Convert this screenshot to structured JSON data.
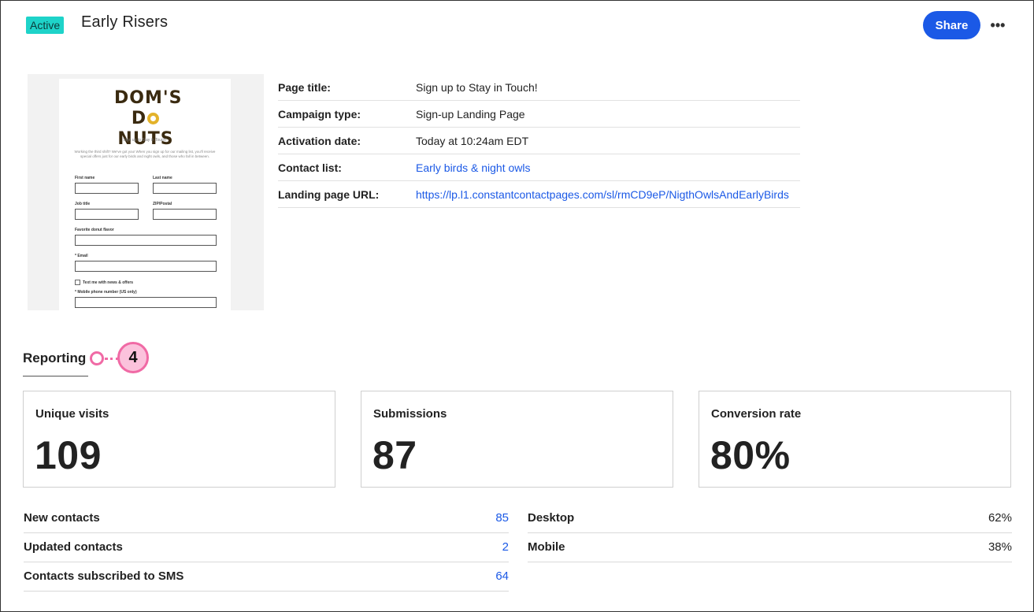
{
  "header": {
    "status_badge": "Active",
    "title": "Early Risers",
    "share_label": "Share",
    "more_label": "•••"
  },
  "preview": {
    "logo_line1_a": "DOM'S",
    "logo_line2_a": "D",
    "logo_line2_b": "NUTS",
    "subtitle": "Sign up to Stay in Touch!",
    "description": "Working the third shift? We've got you! When you sign up for our mailing list, you'll receive special offers just for our early birds and night owls, and those who fall in between.",
    "fields": {
      "first_name": "First name",
      "last_name": "Last name",
      "job_title": "Job title",
      "zip": "ZIP/Postal",
      "donut_flavor": "Favorite donut flavor",
      "email": "* Email",
      "text_me": "Text me with news & offers",
      "mobile": "* Mobile phone number (US only)"
    }
  },
  "details": [
    {
      "label": "Page title:",
      "value": "Sign up to Stay in Touch!"
    },
    {
      "label": "Campaign type:",
      "value": "Sign-up Landing Page"
    },
    {
      "label": "Activation date:",
      "value": "Today at 10:24am EDT"
    },
    {
      "label": "Contact list:",
      "value": "Early birds & night owls"
    },
    {
      "label": "Landing page URL:",
      "value": "https://lp.l1.constantcontactpages.com/sl/rmCD9eP/NigthOwlsAndEarlyBirds"
    }
  ],
  "reporting": {
    "title": "Reporting",
    "callout_number": "4",
    "cards": [
      {
        "label": "Unique visits",
        "value": "109"
      },
      {
        "label": "Submissions",
        "value": "87"
      },
      {
        "label": "Conversion rate",
        "value": "80%"
      }
    ],
    "contacts": [
      {
        "label": "New contacts",
        "value": "85"
      },
      {
        "label": "Updated contacts",
        "value": "2"
      },
      {
        "label": "Contacts subscribed to SMS",
        "value": "64"
      }
    ],
    "devices": [
      {
        "label": "Desktop",
        "value": "62%"
      },
      {
        "label": "Mobile",
        "value": "38%"
      }
    ]
  },
  "colors": {
    "accent": "#1b59e6",
    "badge": "#1ed3c9",
    "callout": "#f06aa5"
  }
}
